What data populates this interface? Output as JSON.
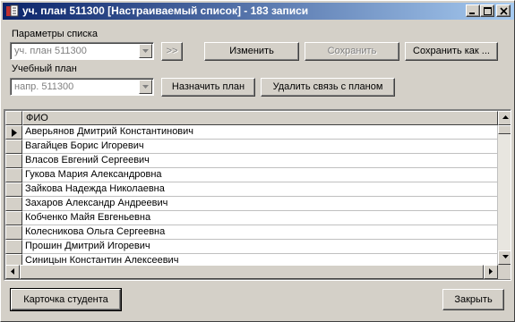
{
  "window": {
    "title": "уч. план 511300 [Настраиваемый список] - 183 записи"
  },
  "params": {
    "label": "Параметры списка",
    "value": "уч. план 511300",
    "arrow_button": ">>",
    "edit_button": "Изменить",
    "save_button": "Сохранить",
    "save_as_button": "Сохранить как ..."
  },
  "plan": {
    "label": "Учебный план",
    "value": "напр. 511300",
    "assign_button": "Назначить план",
    "remove_button": "Удалить связь с планом"
  },
  "table": {
    "header": "ФИО",
    "rows": [
      "Аверьянов Дмитрий Константинович",
      "Вагайцев Борис Игоревич",
      "Власов Евгений Сергеевич",
      "Гукова Мария Александровна",
      "Зайкова Надежда Николаевна",
      "Захаров Александр Андреевич",
      "Кобченко Майя Евгеньевна",
      "Колесникова Ольга Сергеевна",
      "Прошин Дмитрий Игоревич",
      "Синицын Константин Алексеевич"
    ]
  },
  "footer": {
    "student_card_button": "Карточка студента",
    "close_button": "Закрыть"
  },
  "colors": {
    "face": "#d4d0c8",
    "title_start": "#0a246a",
    "title_end": "#a6caf0"
  },
  "icons": {
    "app": "app-icon",
    "minimize": "minimize-icon",
    "maximize": "maximize-icon",
    "close": "close-icon",
    "row_pointer": "row-pointer-icon"
  }
}
